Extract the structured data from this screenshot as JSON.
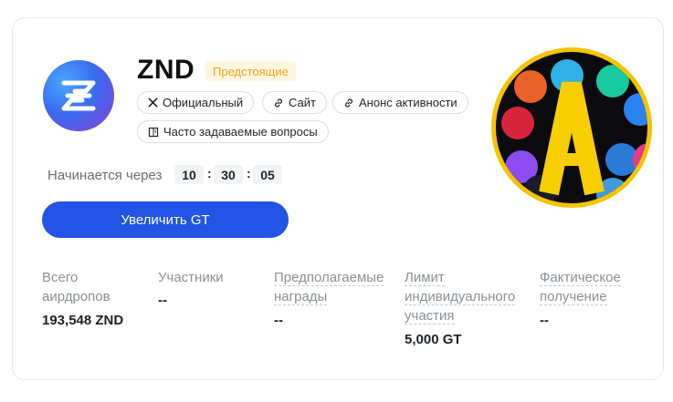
{
  "project": {
    "name": "ZND",
    "status_badge": "Предстоящие"
  },
  "links": [
    {
      "label": "Официальный",
      "icon": "x-icon"
    },
    {
      "label": "Сайт",
      "icon": "link-icon"
    },
    {
      "label": "Анонс активности",
      "icon": "link-icon"
    },
    {
      "label": "Часто задаваемые вопросы",
      "icon": "book-icon"
    }
  ],
  "countdown": {
    "label": "Начинается через",
    "hours": "10",
    "minutes": "30",
    "seconds": "05",
    "separator": ":"
  },
  "cta": {
    "label": "Увеличить GT"
  },
  "stats": [
    {
      "label": "Всего аирдропов",
      "value": "193,548 ZND"
    },
    {
      "label": "Участники",
      "value": "--"
    },
    {
      "label": "Предполагаемые награды",
      "value": "--"
    },
    {
      "label": "Лимит индивидуального участия",
      "value": "5,000 GT"
    },
    {
      "label": "Фактическое получение",
      "value": "--"
    }
  ],
  "banner": {
    "letter": "A",
    "ring_color": "#f4c400",
    "letter_color": "#f7cf00"
  },
  "colors": {
    "accent": "#2354e6",
    "badge_text": "#f0a21b",
    "badge_bg": "#fff6e0"
  }
}
